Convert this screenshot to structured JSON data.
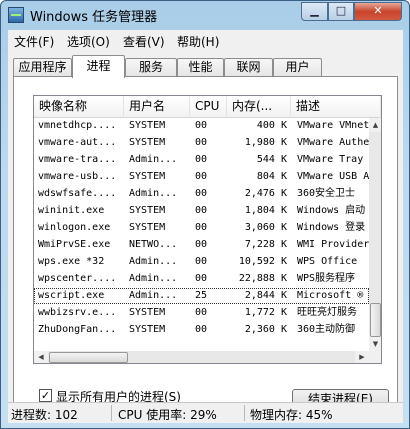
{
  "window": {
    "title": "Windows 任务管理器",
    "controls": {
      "minimize": "▁",
      "maximize": "□",
      "close": "✕"
    }
  },
  "menu": [
    "文件(F)",
    "选项(O)",
    "查看(V)",
    "帮助(H)"
  ],
  "tabs": [
    {
      "label": "应用程序",
      "active": false
    },
    {
      "label": "进程",
      "active": true
    },
    {
      "label": "服务",
      "active": false
    },
    {
      "label": "性能",
      "active": false
    },
    {
      "label": "联网",
      "active": false
    },
    {
      "label": "用户",
      "active": false
    }
  ],
  "columns": [
    "映像名称",
    "用户名",
    "CPU",
    "内存(...",
    "描述"
  ],
  "rows": [
    {
      "name": "vmnetdhcp....",
      "user": "SYSTEM",
      "cpu": "00",
      "mem": "400 K",
      "desc": "VMware VMnet"
    },
    {
      "name": "vmware-aut...",
      "user": "SYSTEM",
      "cpu": "00",
      "mem": "1,980 K",
      "desc": "VMware Authe"
    },
    {
      "name": "vmware-tra...",
      "user": "Admin...",
      "cpu": "00",
      "mem": "544 K",
      "desc": "VMware Tray"
    },
    {
      "name": "vmware-usb...",
      "user": "SYSTEM",
      "cpu": "00",
      "mem": "804 K",
      "desc": "VMware USB A"
    },
    {
      "name": "wdswfsafe....",
      "user": "Admin...",
      "cpu": "00",
      "mem": "2,476 K",
      "desc": "360安全卫士"
    },
    {
      "name": "wininit.exe",
      "user": "SYSTEM",
      "cpu": "00",
      "mem": "1,804 K",
      "desc": "Windows 启动"
    },
    {
      "name": "winlogon.exe",
      "user": "SYSTEM",
      "cpu": "00",
      "mem": "3,060 K",
      "desc": "Windows 登录"
    },
    {
      "name": "WmiPrvSE.exe",
      "user": "NETWO...",
      "cpu": "00",
      "mem": "7,228 K",
      "desc": "WMI Provider"
    },
    {
      "name": "wps.exe *32",
      "user": "Admin...",
      "cpu": "00",
      "mem": "10,592 K",
      "desc": "WPS Office"
    },
    {
      "name": "wpscenter....",
      "user": "Admin...",
      "cpu": "00",
      "mem": "22,888 K",
      "desc": "WPS服务程序"
    },
    {
      "name": "wscript.exe",
      "user": "Admin...",
      "cpu": "25",
      "mem": "2,844 K",
      "desc": "Microsoft ®",
      "selected": true
    },
    {
      "name": "wwbizsrv.e...",
      "user": "SYSTEM",
      "cpu": "00",
      "mem": "1,772 K",
      "desc": "旺旺亮灯服务"
    },
    {
      "name": "ZhuDongFan...",
      "user": "SYSTEM",
      "cpu": "00",
      "mem": "2,360 K",
      "desc": "360主动防御"
    }
  ],
  "show_all_users": {
    "label": "显示所有用户的进程(S)",
    "checked": true,
    "check_glyph": "✓"
  },
  "end_process_button": "结束进程(E)",
  "status": {
    "processes": "进程数: 102",
    "cpu": "CPU 使用率: 29%",
    "memory": "物理内存: 45%"
  },
  "scroll_glyphs": {
    "up": "▲",
    "down": "▼",
    "left": "◀",
    "right": "▶"
  },
  "colors": {
    "title_gradient_top": "#a9cde8",
    "close_button": "#c8442c"
  }
}
